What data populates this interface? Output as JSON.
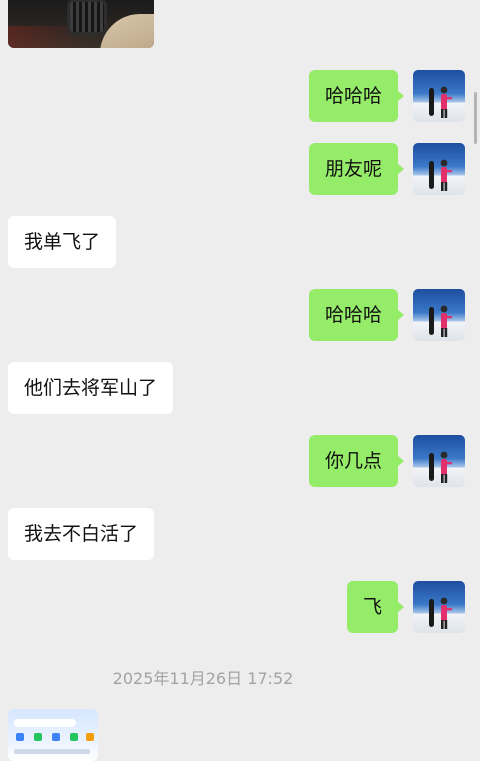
{
  "messages": [
    {
      "side": "out",
      "text": "哈哈哈"
    },
    {
      "side": "out",
      "text": "朋友呢"
    },
    {
      "side": "in",
      "text": "我单飞了"
    },
    {
      "side": "out",
      "text": "哈哈哈"
    },
    {
      "side": "in",
      "text": "他们去将军山了"
    },
    {
      "side": "out",
      "text": "你几点"
    },
    {
      "side": "in",
      "text": "我去不白活了"
    },
    {
      "side": "out",
      "text": "飞"
    }
  ],
  "timestamp": "2025年11月26日 17:52",
  "colors": {
    "background": "#ededed",
    "outgoing_bubble": "#95ec69",
    "incoming_bubble": "#ffffff",
    "timestamp_text": "#a3a3a3"
  },
  "icons": {
    "avatar": "snowboarder-avatar",
    "top_image": "car-interior-photo",
    "bottom_image": "app-screenshot-thumbnail"
  }
}
